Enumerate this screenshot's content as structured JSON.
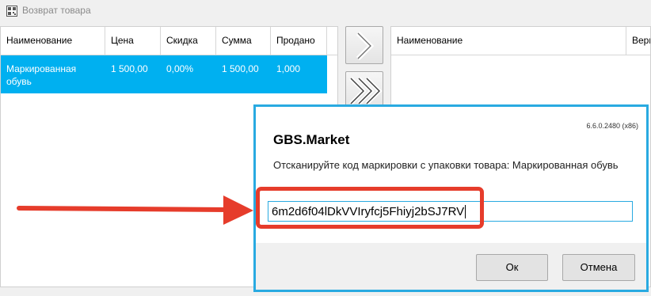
{
  "window": {
    "title": "Возврат товара",
    "icon": "barcode-window-icon"
  },
  "left_table": {
    "columns": [
      "Наименование",
      "Цена",
      "Скидка",
      "Сумма",
      "Продано"
    ],
    "rows": [
      {
        "name": "Маркированная обувь",
        "price": "1 500,00",
        "discount": "0,00%",
        "sum": "1 500,00",
        "sold": "1,000"
      }
    ]
  },
  "transfer_buttons": [
    {
      "icon": "chevron-right-icon"
    },
    {
      "icon": "double-chevron-right-icon"
    }
  ],
  "right_table": {
    "columns": [
      "Наименование",
      "Верн"
    ]
  },
  "dialog": {
    "version": "6.6.0.2480 (x86)",
    "title": "GBS.Market",
    "prompt": "Отсканируйте код маркировки с упаковки товара: Маркированная обувь",
    "input_value": "6m2d6f04lDkVVIryfcj5Fhiyj2bSJ7RV",
    "ok_label": "Ок",
    "cancel_label": "Отмена"
  },
  "annotation": {
    "arrow_color": "#e63c2b",
    "box_color": "#e63c2b"
  },
  "colors": {
    "selection": "#00b0f0",
    "accent": "#29aae1"
  }
}
